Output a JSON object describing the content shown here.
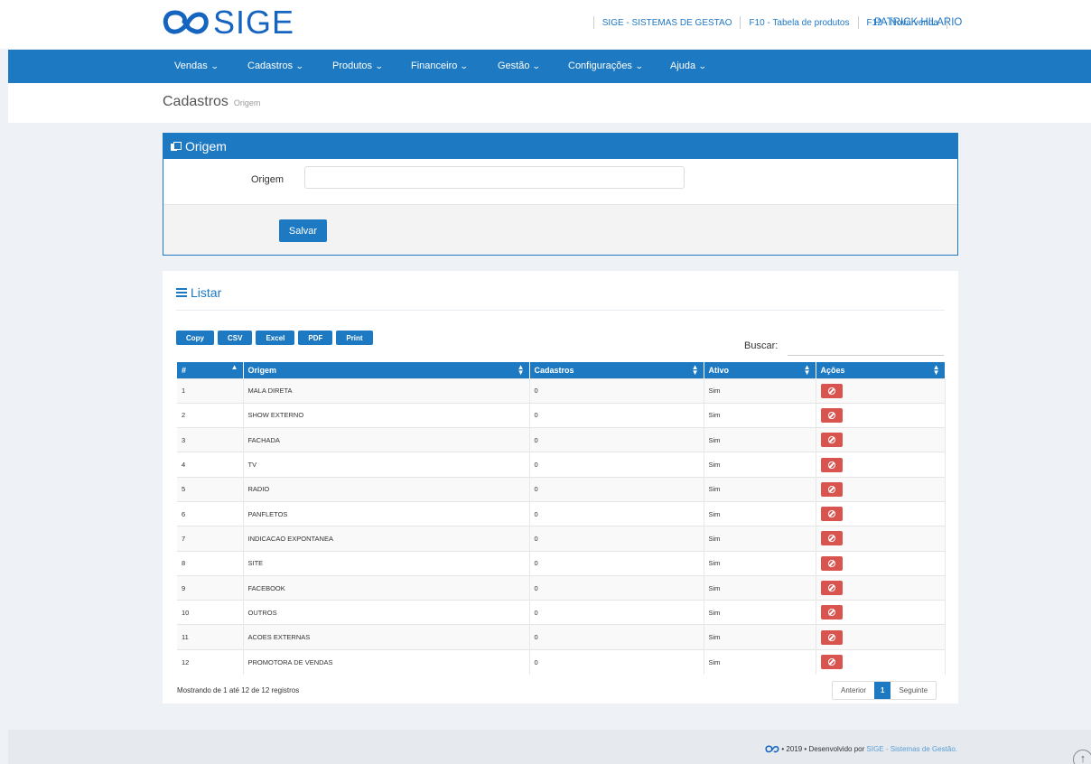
{
  "header": {
    "logo_text": "SIGE",
    "links": [
      "SIGE - SISTEMAS DE GESTAO",
      "F10 - Tabela de produtos",
      "F12 - Nova venda"
    ],
    "user": "PATRICK HILARIO"
  },
  "nav": {
    "items": [
      "Vendas",
      "Cadastros",
      "Produtos",
      "Financeiro",
      "Gestão",
      "Configurações",
      "Ajuda"
    ]
  },
  "page": {
    "title": "Cadastros",
    "subtitle": "Origem"
  },
  "form": {
    "panel_title": "Origem",
    "field_label": "Origem",
    "field_value": "",
    "save_label": "Salvar"
  },
  "list": {
    "title": "Listar",
    "export_buttons": [
      "Copy",
      "CSV",
      "Excel",
      "PDF",
      "Print"
    ],
    "search_label": "Buscar:",
    "search_value": "",
    "columns": [
      "#",
      "Origem",
      "Cadastros",
      "Ativo",
      "Ações"
    ],
    "rows": [
      {
        "id": "1",
        "origem": "MALA DIRETA",
        "cadastros": "0",
        "ativo": "Sim"
      },
      {
        "id": "2",
        "origem": "SHOW EXTERNO",
        "cadastros": "0",
        "ativo": "Sim"
      },
      {
        "id": "3",
        "origem": "FACHADA",
        "cadastros": "0",
        "ativo": "Sim"
      },
      {
        "id": "4",
        "origem": "TV",
        "cadastros": "0",
        "ativo": "Sim"
      },
      {
        "id": "5",
        "origem": "RADIO",
        "cadastros": "0",
        "ativo": "Sim"
      },
      {
        "id": "6",
        "origem": "PANFLETOS",
        "cadastros": "0",
        "ativo": "Sim"
      },
      {
        "id": "7",
        "origem": "INDICACAO EXPONTANEA",
        "cadastros": "0",
        "ativo": "Sim"
      },
      {
        "id": "8",
        "origem": "SITE",
        "cadastros": "0",
        "ativo": "Sim"
      },
      {
        "id": "9",
        "origem": "FACEBOOK",
        "cadastros": "0",
        "ativo": "Sim"
      },
      {
        "id": "10",
        "origem": "OUTROS",
        "cadastros": "0",
        "ativo": "Sim"
      },
      {
        "id": "11",
        "origem": "ACOES EXTERNAS",
        "cadastros": "0",
        "ativo": "Sim"
      },
      {
        "id": "12",
        "origem": "PROMOTORA DE VENDAS",
        "cadastros": "0",
        "ativo": "Sim"
      }
    ],
    "info": "Mostrando de 1 até 12 de 12 registros",
    "pager": {
      "prev": "Anterior",
      "current": "1",
      "next": "Seguinte"
    }
  },
  "footer": {
    "prefix": "• 2019 • Desenvolvido por",
    "brand": "SIGE - Sistemas de Gestão."
  },
  "colors": {
    "primary": "#1d79c2",
    "danger": "#d9534f",
    "page_bg": "#eef1f5"
  },
  "icons": {
    "logo": "infinity-logo-icon",
    "panel": "copy-icon",
    "list": "list-icon",
    "delete": "ban-icon",
    "scroll": "arrow-up-icon"
  }
}
